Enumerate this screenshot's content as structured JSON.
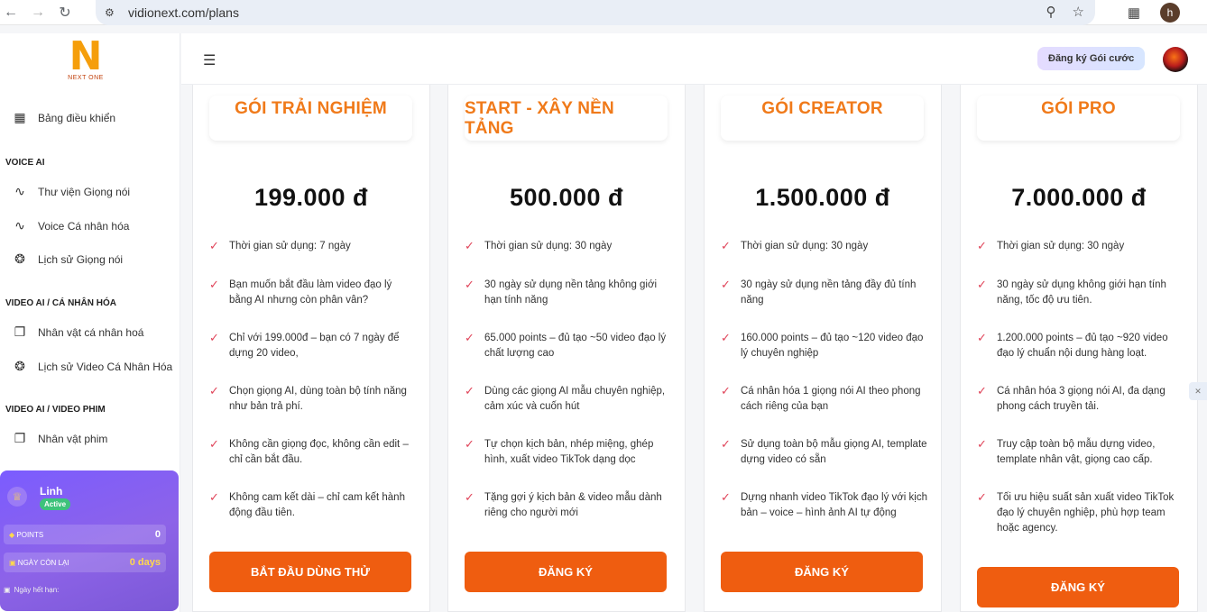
{
  "browser": {
    "url": "vidionext.com/plans",
    "profile_initial": "h"
  },
  "sidebar": {
    "logo_text": "NEXT ONE",
    "items": [
      {
        "label": "Bảng điều khiển",
        "icon": "grid-icon"
      },
      {
        "label": "Thư viện Giọng nói",
        "icon": "waveform-icon"
      },
      {
        "label": "Voice Cá nhân hóa",
        "icon": "waveform-icon"
      },
      {
        "label": "Lịch sử Giọng nói",
        "icon": "aperture-icon"
      },
      {
        "label": "Nhân vật cá nhân hoá",
        "icon": "copy-icon"
      },
      {
        "label": "Lịch sử Video Cá Nhân Hóa",
        "icon": "aperture-icon"
      },
      {
        "label": "Nhân vật phim",
        "icon": "copy-icon"
      }
    ],
    "sections": [
      "VOICE AI",
      "VIDEO AI / CÁ NHÂN HÓA",
      "VIDEO AI / VIDEO PHIM"
    ],
    "user_card": {
      "name": "Linh",
      "status": "Active",
      "points_label": "POINTS",
      "points_value": "0",
      "days_label": "NGÀY CÒN LẠI",
      "days_value": "0 days",
      "expire_label": "Ngày hết hạn:"
    }
  },
  "header": {
    "signup_label": "Đăng ký Gói cước"
  },
  "plans": [
    {
      "title": "GÓI TRẢI NGHIỆM",
      "price": "199.000 đ",
      "features": [
        "Thời gian sử dụng: 7 ngày",
        "Bạn muốn bắt đầu làm video đạo lý bằng AI nhưng còn phân vân?",
        "Chỉ với 199.000đ – bạn có 7 ngày để dựng 20 video,",
        "Chọn giọng AI, dùng toàn bộ tính năng như bản trả phí.",
        "Không cần giọng đọc, không cần edit – chỉ cần bắt đầu.",
        "Không cam kết dài – chỉ cam kết hành động đầu tiên."
      ],
      "cta": "BẮT ĐẦU DÙNG THỬ"
    },
    {
      "title": "START - XÂY NỀN TẢNG",
      "price": "500.000 đ",
      "features": [
        "Thời gian sử dụng: 30 ngày",
        "30 ngày sử dụng nền tảng không giới hạn tính năng",
        "65.000 points – đủ tạo ~50 video đạo lý chất lượng cao",
        "Dùng các giọng AI mẫu chuyên nghiệp, cảm xúc và cuốn hút",
        "Tự chọn kịch bản, nhép miệng, ghép hình, xuất video TikTok dạng dọc",
        "Tặng gợi ý kịch bản & video mẫu dành riêng cho người mới"
      ],
      "cta": "ĐĂNG KÝ"
    },
    {
      "title": "GÓI CREATOR",
      "price": "1.500.000 đ",
      "features": [
        "Thời gian sử dụng: 30 ngày",
        "30 ngày sử dụng nền tảng đầy đủ tính năng",
        "160.000 points – đủ tạo ~120 video đạo lý chuyên nghiệp",
        "Cá nhân hóa 1 giọng nói AI theo phong cách riêng của bạn",
        "Sử dụng toàn bộ mẫu giọng AI, template dựng video có sẵn",
        "Dựng nhanh video TikTok đạo lý với kịch bản – voice – hình ảnh AI tự động"
      ],
      "cta": "ĐĂNG KÝ"
    },
    {
      "title": "GÓI PRO",
      "price": "7.000.000 đ",
      "features": [
        "Thời gian sử dụng: 30 ngày",
        "30 ngày sử dụng không giới hạn tính năng, tốc độ ưu tiên.",
        "1.200.000 points – đủ tạo ~920 video đạo lý chuẩn nội dung hàng loạt.",
        "Cá nhân hóa 3 giọng nói AI, đa dạng phong cách truyền tải.",
        "Truy cập toàn bộ mẫu dựng video, template nhân vật, giọng cao cấp.",
        "Tối ưu hiệu suất sản xuất video TikTok đạo lý chuyên nghiệp, phù hợp team hoặc agency."
      ],
      "cta": "ĐĂNG KÝ"
    }
  ],
  "colors": {
    "accent_orange": "#ef5d10",
    "title_orange": "#f07a1a",
    "check_red": "#e0455a",
    "card_purple": "#7b5cff"
  }
}
